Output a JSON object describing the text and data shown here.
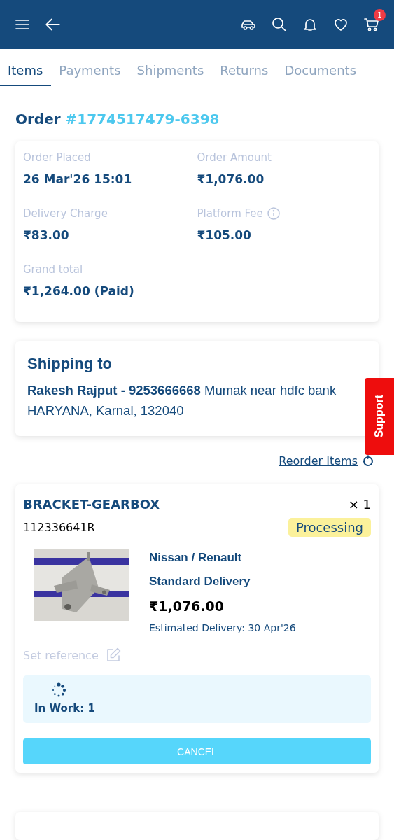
{
  "header": {
    "cart_badge": "1"
  },
  "tabs": [
    {
      "label": "Items",
      "selected": true
    },
    {
      "label": "Payments",
      "selected": false
    },
    {
      "label": "Shipments",
      "selected": false
    },
    {
      "label": "Returns",
      "selected": false
    },
    {
      "label": "Documents",
      "selected": false
    }
  ],
  "order": {
    "label": "Order",
    "number": "#1774517479-6398"
  },
  "summary": [
    {
      "label": "Order Placed",
      "value": "26 Mar'26 15:01",
      "info": false
    },
    {
      "label": "Order Amount",
      "value": "₹1,076.00",
      "info": false
    },
    {
      "label": "Delivery Charge",
      "value": "₹83.00",
      "info": false
    },
    {
      "label": "Platform Fee",
      "value": "₹105.00",
      "info": true
    },
    {
      "label": "Grand total",
      "value": "₹1,264.00 (Paid)",
      "info": false
    }
  ],
  "shipping": {
    "title": "Shipping to",
    "address": "**Rakesh Rajput - 9253666668** Mumak near hdfc bank HARYANA, Karnal, 132040"
  },
  "support": "Support",
  "reorder": "Reorder Items",
  "items": [
    {
      "name": "BRACKET-GEARBOX",
      "quantity": "× 1",
      "part_number": "112336641R",
      "status": "Processing",
      "brand": "Nissan / Renault",
      "delivery_type": "Standard Delivery",
      "price": "₹1,076.00",
      "estimated_delivery": "Estimated Delivery: 30 Apr'26",
      "reference_label": "Set reference",
      "in_work": "In Work: 1",
      "cancel": "CANCEL"
    }
  ]
}
